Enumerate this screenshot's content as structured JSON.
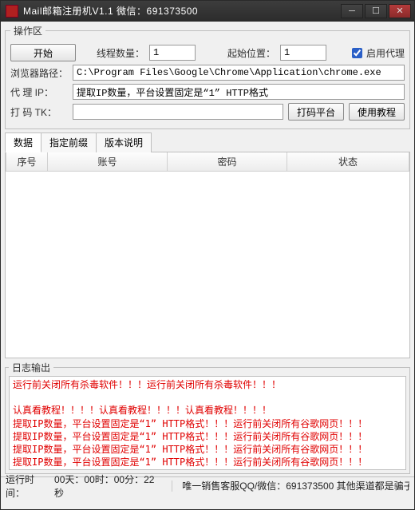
{
  "window": {
    "title": "Mail邮箱注册机V1.1  微信：691373500"
  },
  "ops": {
    "legend": "操作区",
    "start_btn": "开始",
    "thread_label": "线程数量：",
    "thread_value": "1",
    "start_pos_label": "起始位置：",
    "start_pos_value": "1",
    "proxy_chk": "启用代理",
    "browser_path_label": "浏览器路径：",
    "browser_path_value": "C:\\Program Files\\Google\\Chrome\\Application\\chrome.exe",
    "proxy_ip_label": "代 理 IP：",
    "proxy_ip_value": "提取IP数量，平台设置固定是“1” HTTP格式",
    "captcha_tk_label": "打 码 TK：",
    "captcha_tk_value": "",
    "captcha_platform_btn": "打码平台",
    "tutorial_btn": "使用教程"
  },
  "tabs": {
    "data": "数据",
    "prefix": "指定前缀",
    "version": "版本说明"
  },
  "table": {
    "cols": {
      "seq": "序号",
      "account": "账号",
      "password": "密码",
      "status": "状态"
    }
  },
  "log": {
    "legend": "日志输出",
    "lines": [
      "运行前关闭所有杀毒软件！！！运行前关闭所有杀毒软件！！！",
      "",
      "认真看教程！！！！认真看教程！！！！认真看教程！！！！",
      "提取IP数量，平台设置固定是“1” HTTP格式！！！运行前关闭所有谷歌网页！！！",
      "提取IP数量，平台设置固定是“1” HTTP格式！！！运行前关闭所有谷歌网页！！！",
      "提取IP数量，平台设置固定是“1” HTTP格式！！！运行前关闭所有谷歌网页！！！",
      "提取IP数量，平台设置固定是“1” HTTP格式！！！运行前关闭所有谷歌网页！！！"
    ]
  },
  "status": {
    "runtime_label": "运行时间：",
    "runtime_value": "00天：00时：00分：22秒",
    "sales_label": "唯一销售客服QQ/微信：691373500 其他渠道都是骗子"
  }
}
